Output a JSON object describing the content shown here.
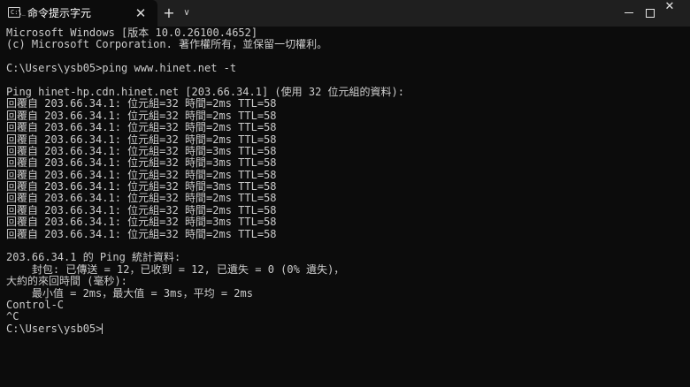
{
  "tab": {
    "title": "命令提示字元",
    "icon": "terminal-icon",
    "icon_prompt": "C:\\_",
    "close_glyph": "✕"
  },
  "titlebar": {
    "new_tab_glyph": "+",
    "dropdown_glyph": "∨",
    "close_glyph": "✕"
  },
  "terminal": {
    "lines": [
      "Microsoft Windows [版本 10.0.26100.4652]",
      "(c) Microsoft Corporation. 著作權所有，並保留一切權利。",
      "",
      "C:\\Users\\ysb05>ping www.hinet.net -t",
      "",
      "Ping hinet-hp.cdn.hinet.net [203.66.34.1] (使用 32 位元組的資料):",
      "回覆自 203.66.34.1: 位元組=32 時間=2ms TTL=58",
      "回覆自 203.66.34.1: 位元組=32 時間=2ms TTL=58",
      "回覆自 203.66.34.1: 位元組=32 時間=2ms TTL=58",
      "回覆自 203.66.34.1: 位元組=32 時間=2ms TTL=58",
      "回覆自 203.66.34.1: 位元組=32 時間=3ms TTL=58",
      "回覆自 203.66.34.1: 位元組=32 時間=3ms TTL=58",
      "回覆自 203.66.34.1: 位元組=32 時間=2ms TTL=58",
      "回覆自 203.66.34.1: 位元組=32 時間=3ms TTL=58",
      "回覆自 203.66.34.1: 位元組=32 時間=2ms TTL=58",
      "回覆自 203.66.34.1: 位元組=32 時間=2ms TTL=58",
      "回覆自 203.66.34.1: 位元組=32 時間=3ms TTL=58",
      "回覆自 203.66.34.1: 位元組=32 時間=2ms TTL=58",
      "",
      "203.66.34.1 的 Ping 統計資料:",
      "    封包: 已傳送 = 12，已收到 = 12, 已遺失 = 0 (0% 遺失)，",
      "大約的來回時間 (毫秒):",
      "    最小值 = 2ms，最大值 = 3ms，平均 = 2ms",
      "Control-C",
      "^C"
    ],
    "prompt": "C:\\Users\\ysb05>"
  }
}
